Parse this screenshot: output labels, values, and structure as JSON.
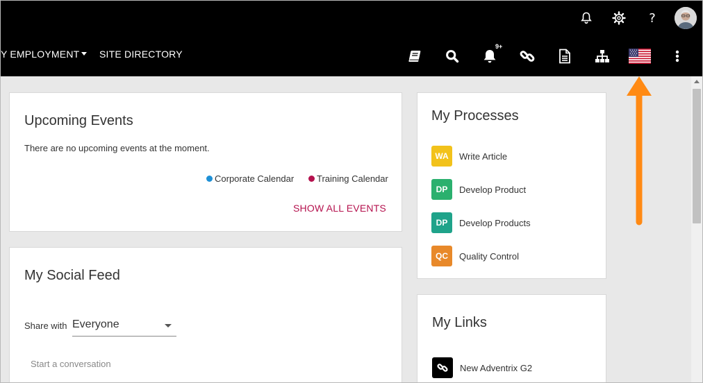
{
  "topbar": {
    "help_glyph": "?",
    "icons": [
      "bell-outline-icon",
      "gear-icon",
      "help-icon",
      "user-avatar"
    ]
  },
  "nav": {
    "items": [
      {
        "label": "Y EMPLOYMENT"
      },
      {
        "label": "SITE DIRECTORY"
      }
    ],
    "notification_badge": "9+",
    "icons": [
      "book-icon",
      "search-icon",
      "bell-icon",
      "link-icon",
      "document-icon",
      "sitemap-icon",
      "us-flag-icon",
      "more-vertical-icon"
    ]
  },
  "events": {
    "title": "Upcoming Events",
    "empty_message": "There are no upcoming events at the moment.",
    "legend": [
      {
        "label": "Corporate Calendar",
        "color": "#1e90d6"
      },
      {
        "label": "Training Calendar",
        "color": "#b5124e"
      }
    ],
    "show_all": "SHOW ALL EVENTS"
  },
  "social": {
    "title": "My Social Feed",
    "share_label": "Share with",
    "share_value": "Everyone",
    "compose_placeholder": "Start a conversation"
  },
  "processes": {
    "title": "My Processes",
    "items": [
      {
        "initials": "WA",
        "label": "Write Article",
        "color": "#f2c21b"
      },
      {
        "initials": "DP",
        "label": "Develop Product",
        "color": "#2bb06e"
      },
      {
        "initials": "DP",
        "label": "Develop Products",
        "color": "#1fa38a"
      },
      {
        "initials": "QC",
        "label": "Quality Control",
        "color": "#e8892a"
      }
    ]
  },
  "links": {
    "title": "My Links",
    "items": [
      {
        "label": "New Adventrix G2"
      }
    ]
  },
  "colors": {
    "accent": "#b5124e",
    "arrow": "#ff8a14",
    "header": "#000000",
    "background": "#e8e8e8"
  }
}
